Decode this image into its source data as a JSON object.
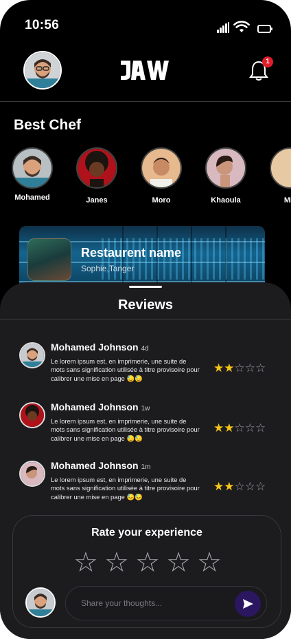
{
  "status_bar": {
    "time": "10:56"
  },
  "header": {
    "notification_count": "1",
    "logo": "JAW"
  },
  "best_chef": {
    "title": "Best Chef",
    "chefs": [
      {
        "name": "Mohamed"
      },
      {
        "name": "Janes"
      },
      {
        "name": "Moro"
      },
      {
        "name": "Khaoula"
      },
      {
        "name": "Mia"
      }
    ]
  },
  "restaurant": {
    "name": "Restaurent name",
    "location": "Sophie,Tanger"
  },
  "reviews": {
    "title": "Reviews",
    "items": [
      {
        "name": "Mohamed Johnson",
        "ago": "4d",
        "text": "Le lorem ipsum est, en imprimerie, une suite de mots sans signification utilisée à titre provisoire pour calibrer une mise en page 😓😓",
        "rating": 2,
        "out_of": 5
      },
      {
        "name": "Mohamed Johnson",
        "ago": "1w",
        "text": "Le lorem ipsum est, en imprimerie, une suite de mots sans signification utilisée à titre provisoire pour calibrer une mise en page 😓😓",
        "rating": 2,
        "out_of": 5
      },
      {
        "name": "Mohamed Johnson",
        "ago": "1m",
        "text": "Le lorem ipsum est, en imprimerie, une suite de mots sans signification utilisée à titre provisoire pour calibrer une mise en page 😓😓",
        "rating": 2,
        "out_of": 5
      }
    ]
  },
  "rate": {
    "title": "Rate your experience",
    "stars": 5,
    "placeholder": "Share your thoughts..."
  },
  "colors": {
    "background": "#000000",
    "sheet": "#1c1c1f",
    "star": "#f5c518",
    "accent": "#2a1760",
    "badge": "#e11d2b"
  }
}
